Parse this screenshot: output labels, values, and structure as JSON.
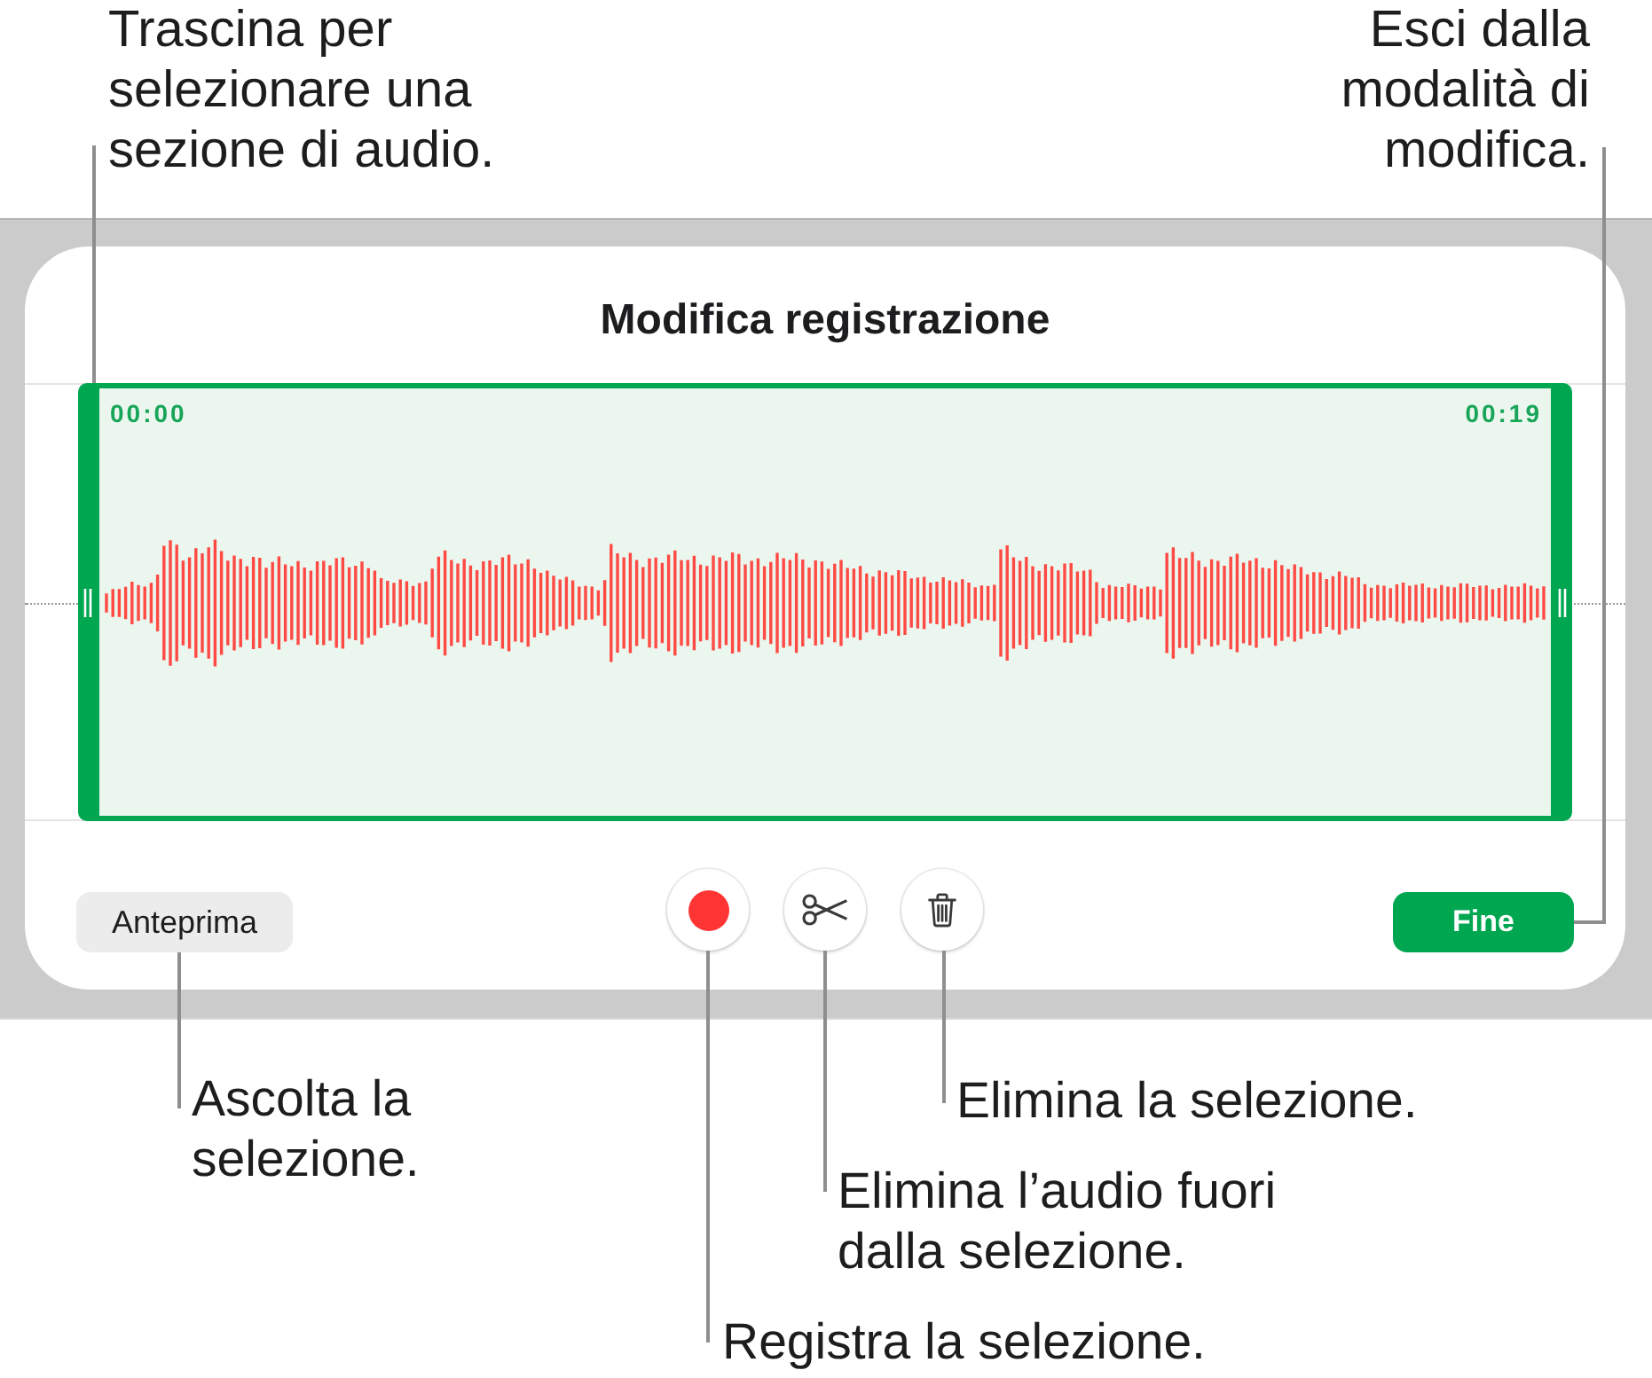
{
  "editor": {
    "title": "Modifica registrazione",
    "selection": {
      "start_time": "00:00",
      "end_time": "00:19"
    },
    "buttons": [
      {
        "kind": "preview",
        "label": "Anteprima"
      },
      {
        "kind": "record"
      },
      {
        "kind": "trim"
      },
      {
        "kind": "delete"
      },
      {
        "kind": "done",
        "label": "Fine"
      }
    ]
  },
  "callouts": [
    {
      "kind": "selection",
      "text": "Trascina per\nselezionare una\nsezione di audio."
    },
    {
      "kind": "done",
      "text": "Esci dalla\nmodalità di\nmodifica."
    },
    {
      "kind": "preview",
      "text": "Ascolta la\nselezione."
    },
    {
      "kind": "delete",
      "text": "Elimina la selezione."
    },
    {
      "kind": "trim",
      "text": "Elimina l’audio fuori\ndalla selezione."
    },
    {
      "kind": "record",
      "text": "Registra la selezione."
    }
  ]
}
